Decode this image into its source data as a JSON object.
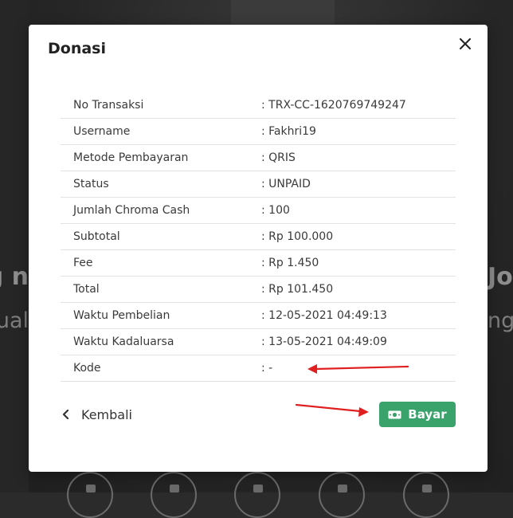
{
  "background": {
    "left_text_1": "g n",
    "left_text_2": "ual",
    "right_text_1": "Jo",
    "right_text_2": "ng"
  },
  "modal": {
    "title": "Donasi",
    "close_icon": "close-icon",
    "rows": [
      {
        "label": "No Transaksi",
        "value": ": TRX-CC-1620769749247"
      },
      {
        "label": "Username",
        "value": ": Fakhri19"
      },
      {
        "label": "Metode Pembayaran",
        "value": ": QRIS"
      },
      {
        "label": "Status",
        "value": ": UNPAID"
      },
      {
        "label": "Jumlah Chroma Cash",
        "value": ": 100"
      },
      {
        "label": "Subtotal",
        "value": ": Rp 100.000"
      },
      {
        "label": "Fee",
        "value": ": Rp 1.450"
      },
      {
        "label": "Total",
        "value": ": Rp 101.450"
      },
      {
        "label": "Waktu Pembelian",
        "value": ": 12-05-2021 04:49:13"
      },
      {
        "label": "Waktu Kadaluarsa",
        "value": ": 13-05-2021 04:49:09"
      },
      {
        "label": "Kode",
        "value": ":  -"
      }
    ],
    "back_label": "Kembali",
    "pay_label": "Bayar"
  },
  "colors": {
    "pay_button": "#3aa36b",
    "annotation_arrow": "#e02020",
    "modal_background": "#ffffff",
    "overlay_background": "#2b2b2b"
  },
  "icons": {
    "back": "chevron-left-icon",
    "pay": "money-icon",
    "close": "close-icon"
  }
}
